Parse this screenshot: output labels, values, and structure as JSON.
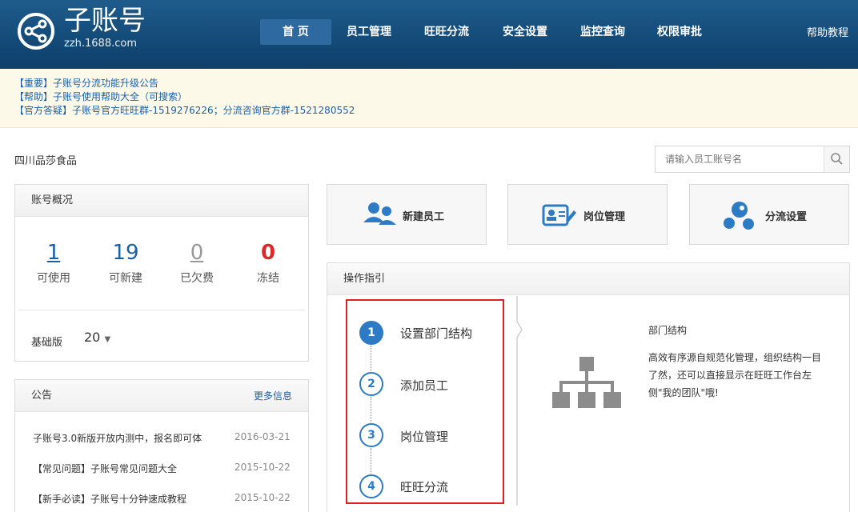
{
  "header": {
    "logo_title": "子账号",
    "logo_sub": "zzh.1688.com",
    "nav": [
      {
        "label": "首 页",
        "active": true
      },
      {
        "label": "员工管理"
      },
      {
        "label": "旺旺分流"
      },
      {
        "label": "安全设置"
      },
      {
        "label": "监控查询"
      },
      {
        "label": "权限审批"
      }
    ],
    "help": "帮助教程"
  },
  "notices": [
    "【重要】子账号分流功能升级公告",
    "【帮助】子账号使用帮助大全（可搜索）",
    "【官方答疑】子账号官方旺旺群-1519276226；分流咨询官方群-1521280552"
  ],
  "company": "四川品莎食品",
  "search": {
    "placeholder": "请输入员工账号名"
  },
  "overview": {
    "title": "账号概况",
    "stats": [
      {
        "value": "1",
        "label": "可使用"
      },
      {
        "value": "19",
        "label": "可新建"
      },
      {
        "value": "0",
        "label": "已欠费"
      },
      {
        "value": "0",
        "label": "冻结"
      }
    ],
    "edition_label": "基础版",
    "edition_value": "20"
  },
  "announcements": {
    "title": "公告",
    "more": "更多信息",
    "items": [
      {
        "text": "子账号3.0新版开放内测中，报名即可体",
        "date": "2016-03-21"
      },
      {
        "text": "【常见问题】子账号常见问题大全",
        "date": "2015-10-22"
      },
      {
        "text": "【新手必读】子账号十分钟速成教程",
        "date": "2015-10-22"
      }
    ]
  },
  "actions": [
    {
      "label": "新建员工",
      "icon": "users-icon"
    },
    {
      "label": "岗位管理",
      "icon": "id-card-icon"
    },
    {
      "label": "分流设置",
      "icon": "network-bubbles-icon"
    }
  ],
  "guide": {
    "title": "操作指引",
    "steps": [
      {
        "num": "1",
        "label": "设置部门结构"
      },
      {
        "num": "2",
        "label": "添加员工"
      },
      {
        "num": "3",
        "label": "岗位管理"
      },
      {
        "num": "4",
        "label": "旺旺分流"
      }
    ],
    "detail_title": "部门结构",
    "detail_lines": [
      "高效有序源自规范化管理，组织结构一目",
      "了然，还可以直接显示在旺旺工作台左",
      "侧\"我的团队\"哦!"
    ]
  },
  "colors": {
    "header": "#134a77",
    "accent": "#2d7bc4",
    "notice_bg": "#fdf9e8",
    "frozen": "#d92b2b",
    "highlight_border": "#e02020"
  }
}
